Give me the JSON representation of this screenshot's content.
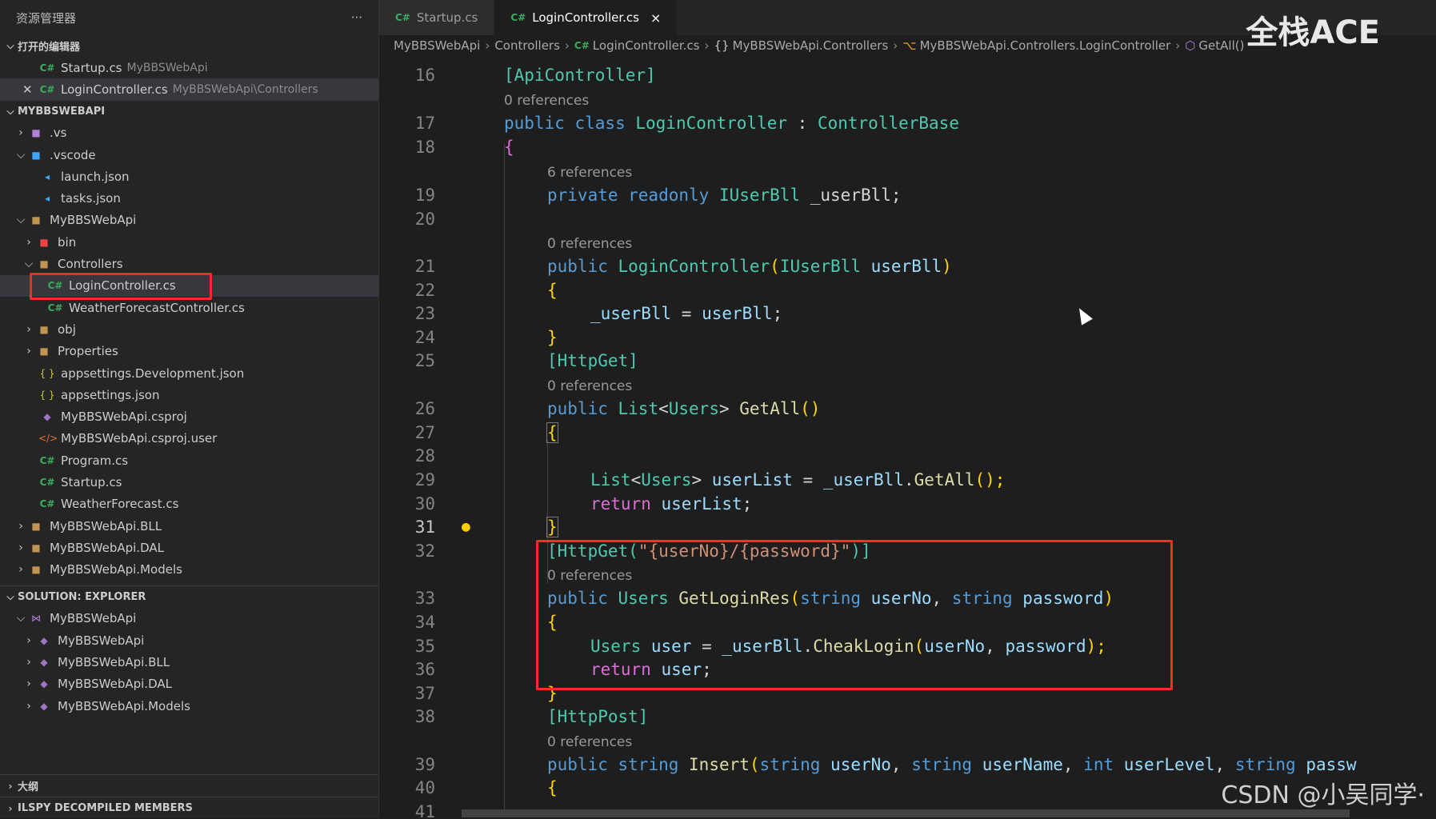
{
  "sidebar": {
    "title": "资源管理器",
    "more": "···",
    "open_editors": {
      "label": "打开的编辑器",
      "items": [
        {
          "name": "Startup.cs",
          "desc": "MyBBSWebApi"
        },
        {
          "name": "LoginController.cs",
          "desc": "MyBBSWebApi\\Controllers"
        }
      ]
    },
    "project": {
      "label": "MYBBSWEBAPI",
      "items": [
        ".vs",
        ".vscode",
        "launch.json",
        "tasks.json",
        "MyBBSWebApi",
        "bin",
        "Controllers",
        "LoginController.cs",
        "WeatherForecastController.cs",
        "obj",
        "Properties",
        "appsettings.Development.json",
        "appsettings.json",
        "MyBBSWebApi.csproj",
        "MyBBSWebApi.csproj.user",
        "Program.cs",
        "Startup.cs",
        "WeatherForecast.cs",
        "MyBBSWebApi.BLL",
        "MyBBSWebApi.DAL",
        "MyBBSWebApi.Models"
      ]
    },
    "solution": {
      "label": "SOLUTION: EXPLORER",
      "items": [
        "MyBBSWebApi",
        "MyBBSWebApi",
        "MyBBSWebApi.BLL",
        "MyBBSWebApi.DAL",
        "MyBBSWebApi.Models"
      ]
    },
    "outline": "大纲",
    "ilspy": "ILSPY DECOMPILED MEMBERS"
  },
  "tabs": [
    {
      "label": "Startup.cs"
    },
    {
      "label": "LoginController.cs",
      "close": "×"
    }
  ],
  "breadcrumb": [
    "MyBBSWebApi",
    "Controllers",
    "LoginController.cs",
    "MyBBSWebApi.Controllers",
    "MyBBSWebApi.Controllers.LoginController",
    "GetAll()"
  ],
  "editor": {
    "line_numbers": [
      "16",
      "17",
      "18",
      "19",
      "20",
      "21",
      "22",
      "23",
      "24",
      "25",
      "26",
      "27",
      "28",
      "29",
      "30",
      "31",
      "32",
      "33",
      "34",
      "35",
      "36",
      "37",
      "38",
      "39",
      "40",
      "41"
    ],
    "lens_0": "0 references",
    "lens_6": "6 references",
    "lines": {
      "l16": "[ApiController]",
      "l17a": "public class ",
      "l17b": "LoginController",
      "l17c": " : ",
      "l17d": "ControllerBase",
      "l18": "{",
      "l19a": "private readonly ",
      "l19b": "IUserBll",
      "l19c": " _userBll;",
      "l21a": "public ",
      "l21b": "LoginController",
      "l21c": "(",
      "l21d": "IUserBll",
      "l21e": " userBll",
      "l21f": ")",
      "l22": "{",
      "l23a": "_userBll",
      "l23b": " = ",
      "l23c": "userBll",
      "l23d": ";",
      "l24": "}",
      "l25": "[HttpGet]",
      "l26a": "public ",
      "l26b": "List",
      "l26c": "<",
      "l26d": "Users",
      "l26e": "> ",
      "l26f": "GetAll",
      "l26g": "()",
      "l27": "{",
      "l29a": "List",
      "l29b": "<",
      "l29c": "Users",
      "l29d": "> ",
      "l29e": "userList",
      "l29f": " = ",
      "l29g": "_userBll",
      "l29h": ".",
      "l29i": "GetAll",
      "l29j": "();",
      "l30a": "return ",
      "l30b": "userList",
      "l30c": ";",
      "l31": "}",
      "l32a": "[HttpGet(",
      "l32b": "\"{userNo}/{password}\"",
      "l32c": ")]",
      "l33a": "public ",
      "l33b": "Users",
      "l33c": " ",
      "l33d": "GetLoginRes",
      "l33e": "(",
      "l33f": "string",
      "l33g": " userNo",
      "l33h": ", ",
      "l33i": "string",
      "l33j": " password",
      "l33k": ")",
      "l34": "{",
      "l35a": "Users",
      "l35b": " user",
      "l35c": " = ",
      "l35d": "_userBll",
      "l35e": ".",
      "l35f": "CheakLogin",
      "l35g": "(",
      "l35h": "userNo",
      "l35i": ", ",
      "l35j": "password",
      "l35k": ");",
      "l36a": "return ",
      "l36b": "user",
      "l36c": ";",
      "l37": "}",
      "l38": "[HttpPost]",
      "l39a": "public ",
      "l39b": "string",
      "l39c": " ",
      "l39d": "Insert",
      "l39e": "(",
      "l39f": "string",
      "l39g": " userNo",
      "l39h": ", ",
      "l39i": "string",
      "l39j": " userName",
      "l39k": ", ",
      "l39l": "int",
      "l39m": " userLevel",
      "l39n": ", ",
      "l39o": "string",
      "l39p": " passw",
      "l40": "{"
    }
  },
  "watermarks": {
    "top": "全栈ACE",
    "bottom": "CSDN @小吴同学·"
  },
  "colors": {
    "highlight_box": "#ff2a2a",
    "bg": "#1e1e1e",
    "sidebar": "#252526"
  }
}
